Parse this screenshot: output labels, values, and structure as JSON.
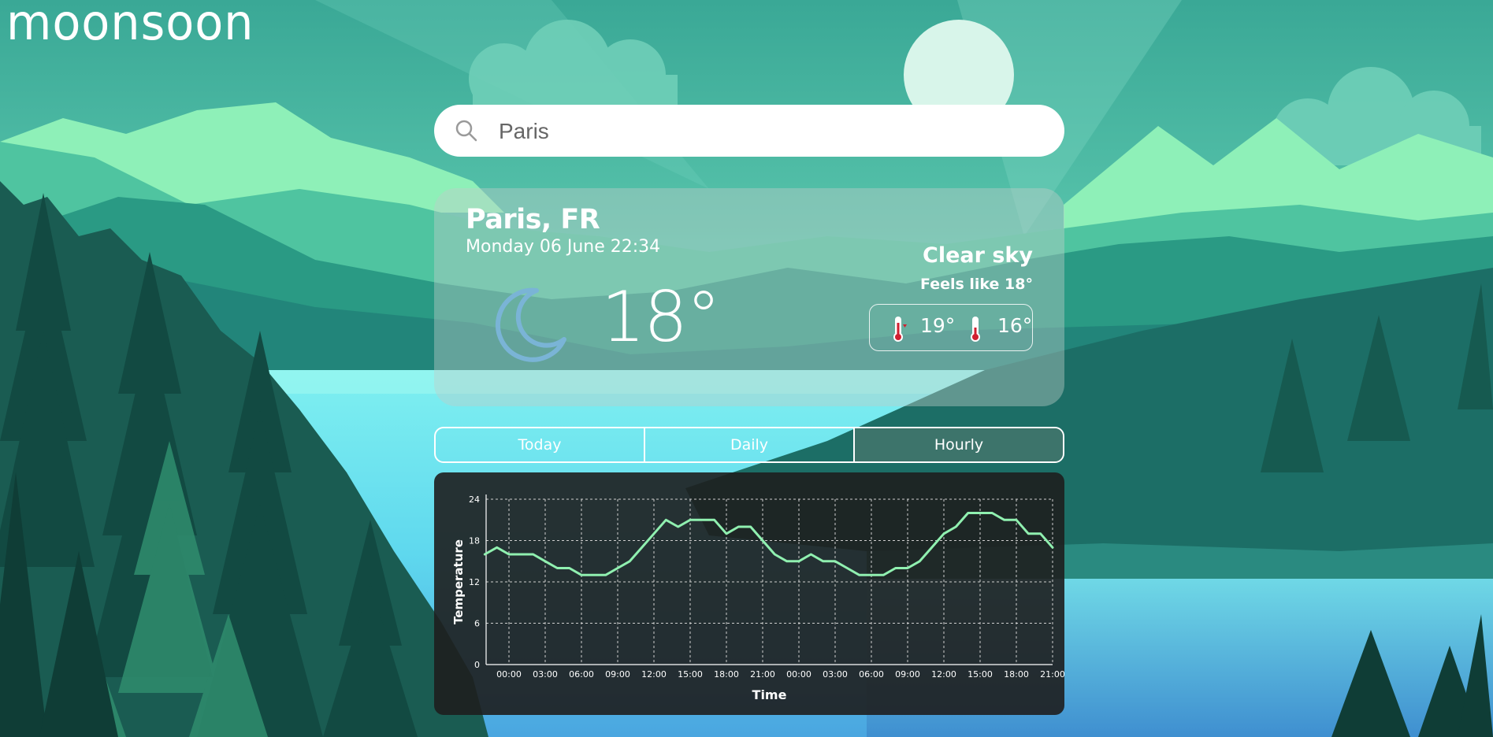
{
  "app": {
    "logo": "moonsoon"
  },
  "search": {
    "value": "Paris",
    "icon": "search-icon"
  },
  "weather": {
    "location": "Paris, FR",
    "datetime": "Monday 06 June 22:34",
    "temperature": "18°",
    "condition_icon": "moon-icon",
    "description": "Clear sky",
    "feels_like": "Feels like 18°",
    "max": "19°",
    "min": "16°"
  },
  "tabs": [
    {
      "label": "Today",
      "active": false
    },
    {
      "label": "Daily",
      "active": false
    },
    {
      "label": "Hourly",
      "active": true
    }
  ],
  "colors": {
    "line": "#90f0b0",
    "accent": "#ffffff",
    "moon": "#7ab4d6"
  },
  "chart_data": {
    "type": "line",
    "title": "",
    "xlabel": "Time",
    "ylabel": "Temperature",
    "ylim": [
      0,
      24
    ],
    "yticks": [
      0,
      6,
      12,
      18,
      24
    ],
    "xticks": [
      "00:00",
      "03:00",
      "06:00",
      "09:00",
      "12:00",
      "15:00",
      "18:00",
      "21:00",
      "00:00",
      "03:00",
      "06:00",
      "09:00",
      "12:00",
      "15:00",
      "18:00",
      "21:00"
    ],
    "grid": true,
    "x_hours_from_first_tick": [
      -2,
      -1,
      0,
      1,
      2,
      3,
      4,
      5,
      6,
      7,
      8,
      9,
      10,
      11,
      12,
      13,
      14,
      15,
      16,
      17,
      18,
      19,
      20,
      21,
      22,
      23,
      24,
      25,
      26,
      27,
      28,
      29,
      30,
      31,
      32,
      33,
      34,
      35,
      36,
      37,
      38,
      39,
      40,
      41,
      42,
      43,
      44,
      45,
      46,
      47,
      48,
      49,
      50
    ],
    "series": [
      {
        "values": [
          16,
          17,
          16,
          16,
          16,
          15,
          14,
          14,
          13,
          13,
          13,
          14,
          15,
          17,
          19,
          21,
          20,
          21,
          21,
          21,
          19,
          20,
          20,
          18,
          16,
          15,
          15,
          16,
          15,
          15,
          14,
          13,
          13,
          13,
          14,
          14,
          15,
          17,
          19,
          20,
          22,
          22,
          22,
          21,
          21,
          19,
          19,
          17
        ]
      }
    ]
  }
}
